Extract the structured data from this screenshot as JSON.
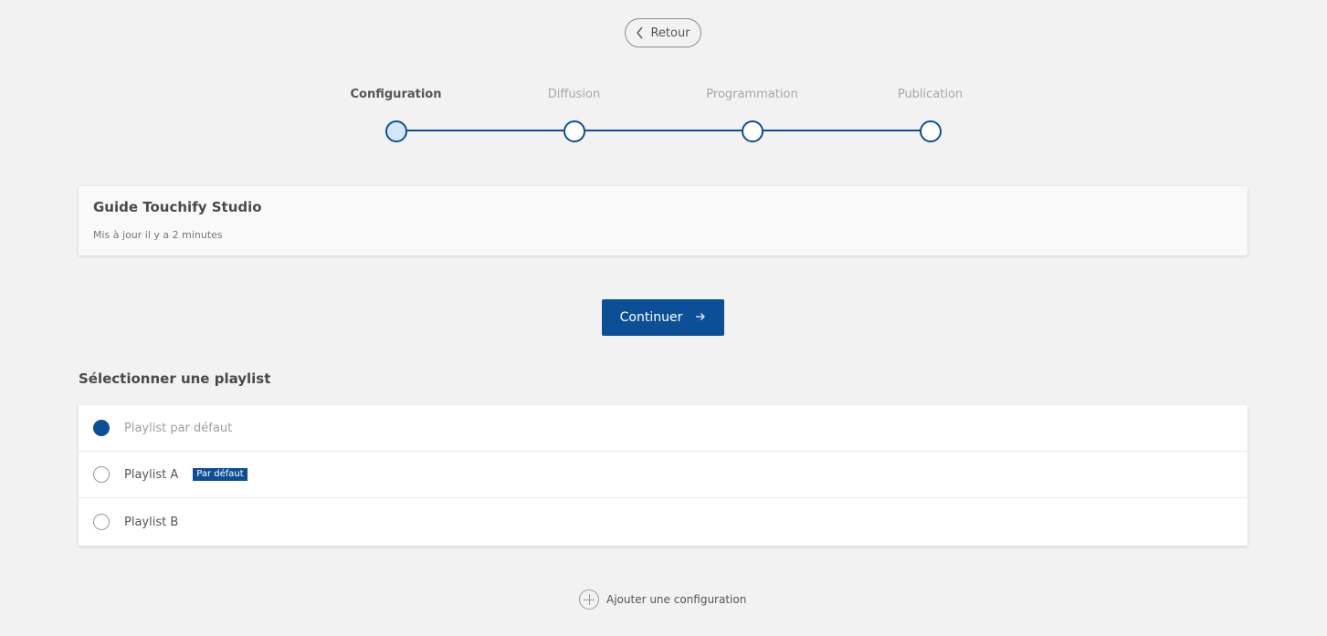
{
  "header": {
    "back_label": "Retour"
  },
  "stepper": {
    "steps": [
      {
        "label": "Configuration",
        "active": true
      },
      {
        "label": "Diffusion",
        "active": false
      },
      {
        "label": "Programmation",
        "active": false
      },
      {
        "label": "Publication",
        "active": false
      }
    ]
  },
  "guide": {
    "title": "Guide Touchify Studio",
    "subtitle": "Mis à jour il y a 2 minutes"
  },
  "actions": {
    "continue_label": "Continuer"
  },
  "playlists": {
    "section_title": "Sélectionner une playlist",
    "items": [
      {
        "label": "Playlist par défaut",
        "checked": true,
        "badge": ""
      },
      {
        "label": "Playlist A",
        "checked": false,
        "badge": "Par défaut"
      },
      {
        "label": "Playlist B",
        "checked": false,
        "badge": ""
      }
    ]
  },
  "footer": {
    "add_label": "Ajouter une configuration"
  },
  "colors": {
    "accent": "#0d4f96",
    "background": "#f2f2f2",
    "active_step_fill": "#d4e7f7"
  },
  "icons": {
    "back": "chevron-left-icon",
    "continue": "arrow-right-icon",
    "add": "plus-circle-icon"
  }
}
